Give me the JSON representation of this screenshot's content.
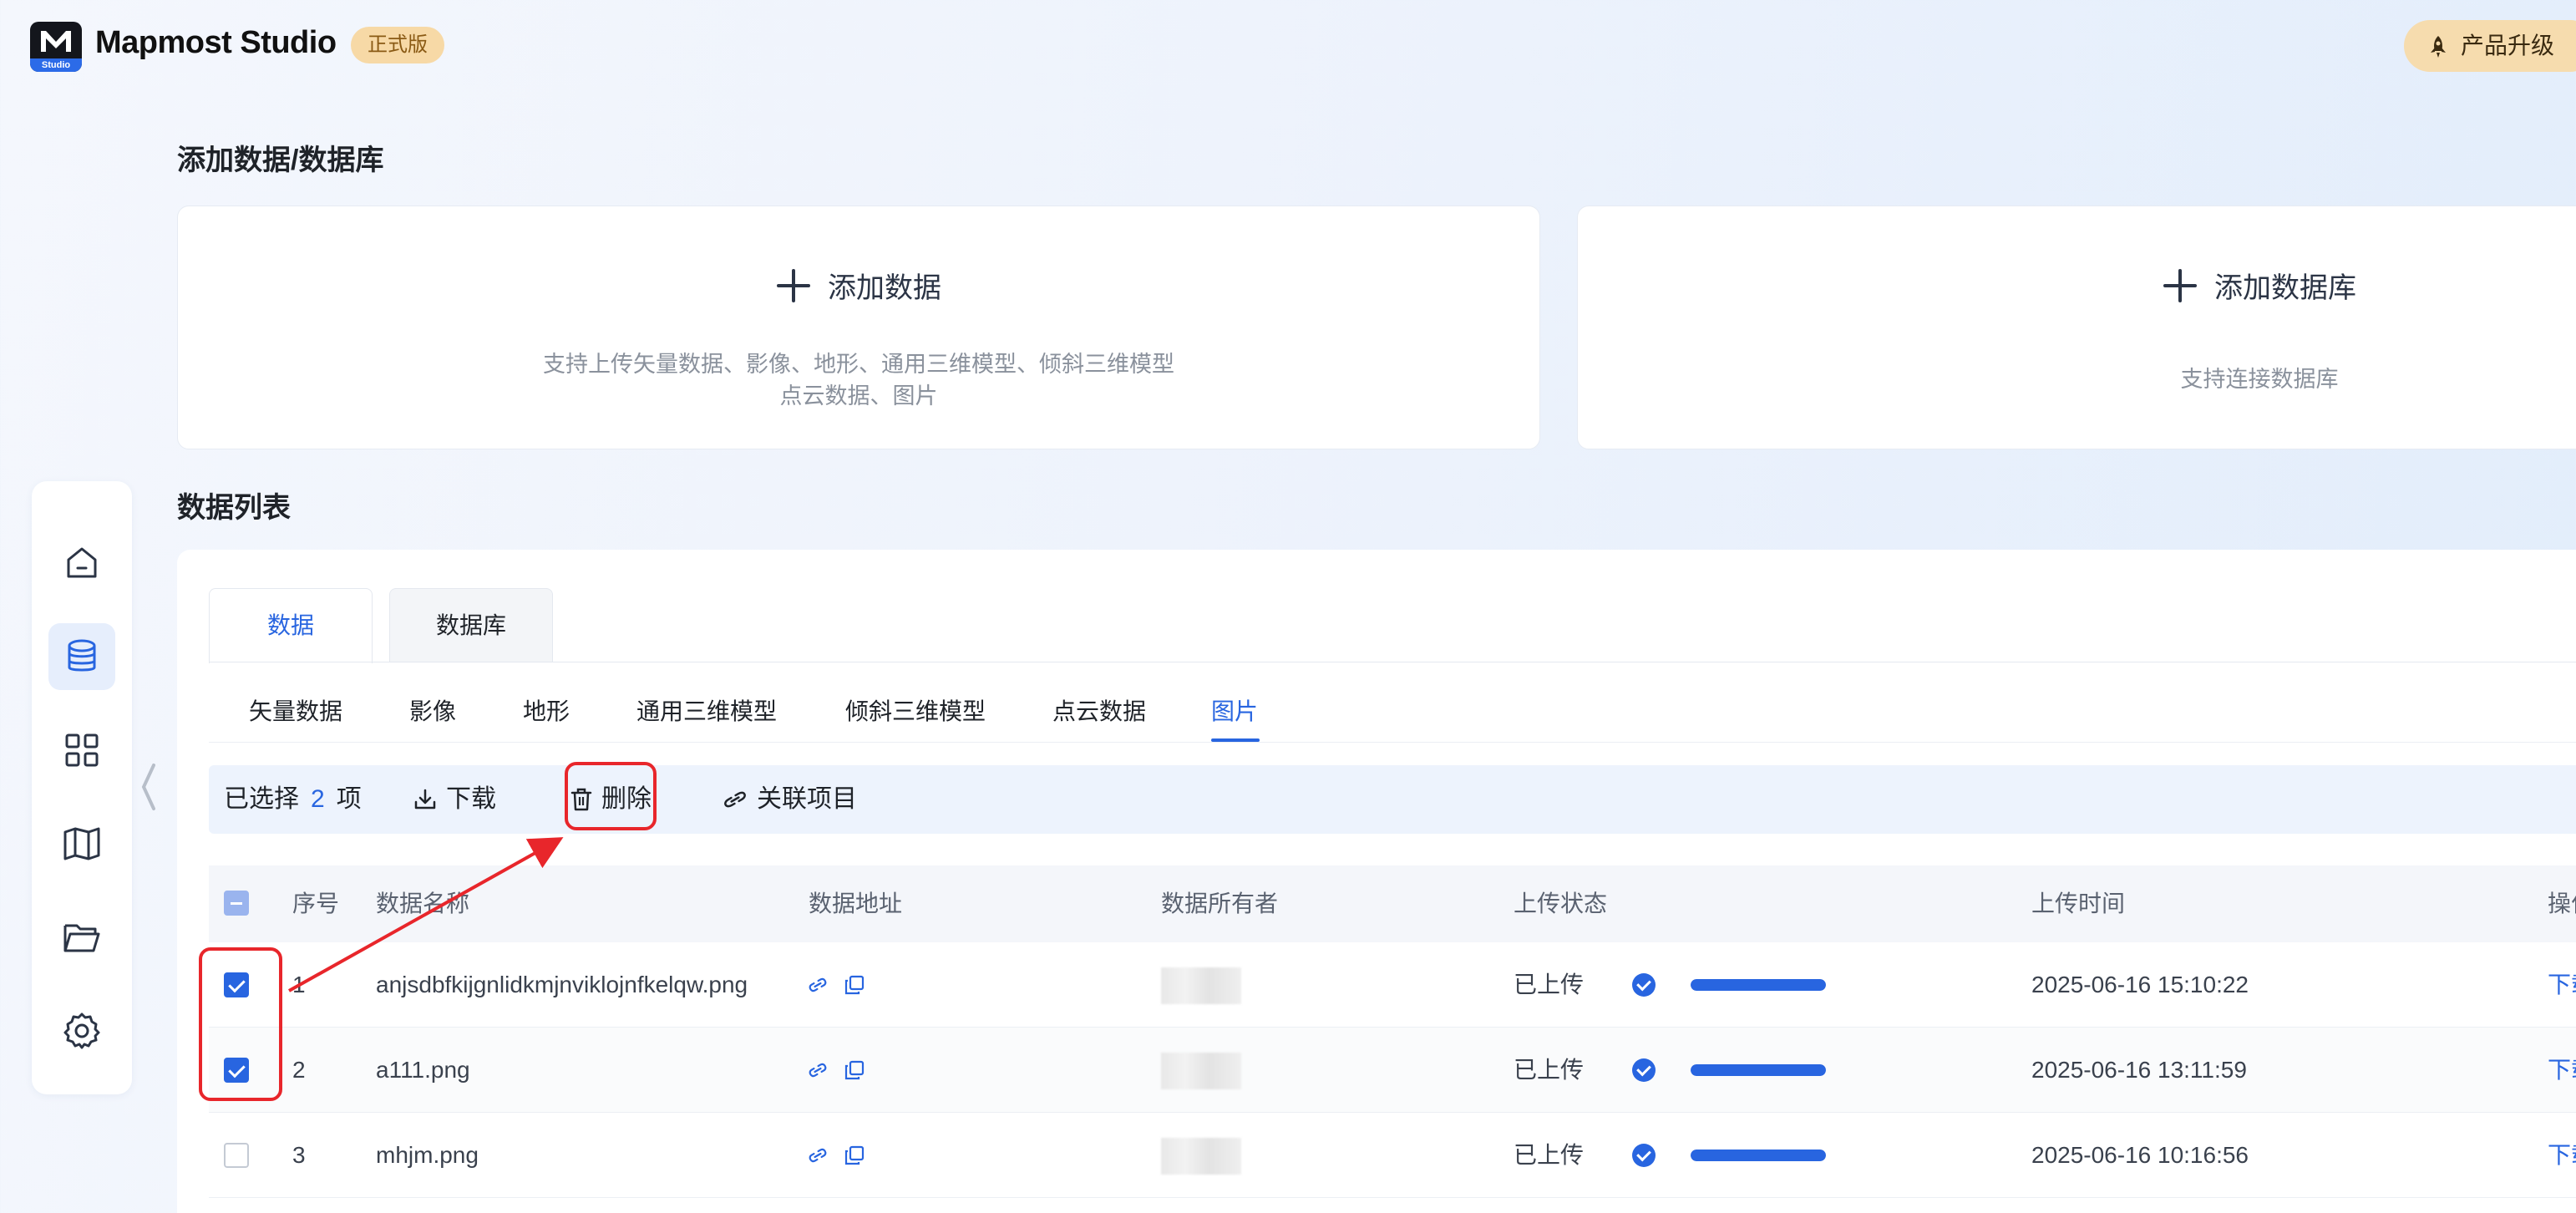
{
  "header": {
    "brand": "Mapmost Studio",
    "logo_sub": "Studio",
    "edition_badge": "正式版",
    "upgrade_label": "产品升级",
    "upgrade_icon": "rocket-icon"
  },
  "sidebar": {
    "items": [
      {
        "name": "home",
        "icon": "home-icon",
        "active": false
      },
      {
        "name": "data",
        "icon": "database-icon",
        "active": true
      },
      {
        "name": "apps",
        "icon": "grid-icon",
        "active": false
      },
      {
        "name": "map",
        "icon": "map-icon",
        "active": false
      },
      {
        "name": "projects",
        "icon": "folder-icon",
        "active": false
      },
      {
        "name": "settings",
        "icon": "gear-icon",
        "active": false
      }
    ],
    "collapse_icon": "chevron-left-icon"
  },
  "add_section": {
    "title": "添加数据/数据库",
    "add_data": {
      "label": "添加数据",
      "desc_line1": "支持上传矢量数据、影像、地形、通用三维模型、倾斜三维模型",
      "desc_line2": "点云数据、图片"
    },
    "add_db": {
      "label": "添加数据库",
      "desc": "支持连接数据库"
    }
  },
  "list_section": {
    "title": "数据列表",
    "tabs": [
      {
        "label": "数据",
        "active": true
      },
      {
        "label": "数据库",
        "active": false
      }
    ],
    "subtabs": [
      {
        "label": "矢量数据",
        "active": false
      },
      {
        "label": "影像",
        "active": false
      },
      {
        "label": "地形",
        "active": false
      },
      {
        "label": "通用三维模型",
        "active": false
      },
      {
        "label": "倾斜三维模型",
        "active": false
      },
      {
        "label": "点云数据",
        "active": false
      },
      {
        "label": "图片",
        "active": true
      }
    ],
    "action_bar": {
      "selected_prefix": "已选择",
      "selected_count": "2",
      "selected_suffix": "项",
      "download": "下载",
      "delete": "删除",
      "link_project": "关联项目"
    },
    "columns": [
      "序号",
      "数据名称",
      "数据地址",
      "数据所有者",
      "上传状态",
      "上传时间",
      "操作"
    ],
    "rows": [
      {
        "checked": true,
        "index": "1",
        "name": "anjsdbfkijgnlidkmjnviklojnfkelqw.png",
        "status": "已上传",
        "progress": 1.0,
        "time": "2025-06-16 15:10:22",
        "op": "下载"
      },
      {
        "checked": true,
        "index": "2",
        "name": "a111.png",
        "status": "已上传",
        "progress": 1.0,
        "time": "2025-06-16 13:11:59",
        "op": "下载"
      },
      {
        "checked": false,
        "index": "3",
        "name": "mhjm.png",
        "status": "已上传",
        "progress": 1.0,
        "time": "2025-06-16 10:16:56",
        "op": "下载"
      }
    ]
  },
  "colors": {
    "accent": "#2865e0",
    "annotation_red": "#e8262b",
    "badge_bg": "#f7d9a6"
  }
}
